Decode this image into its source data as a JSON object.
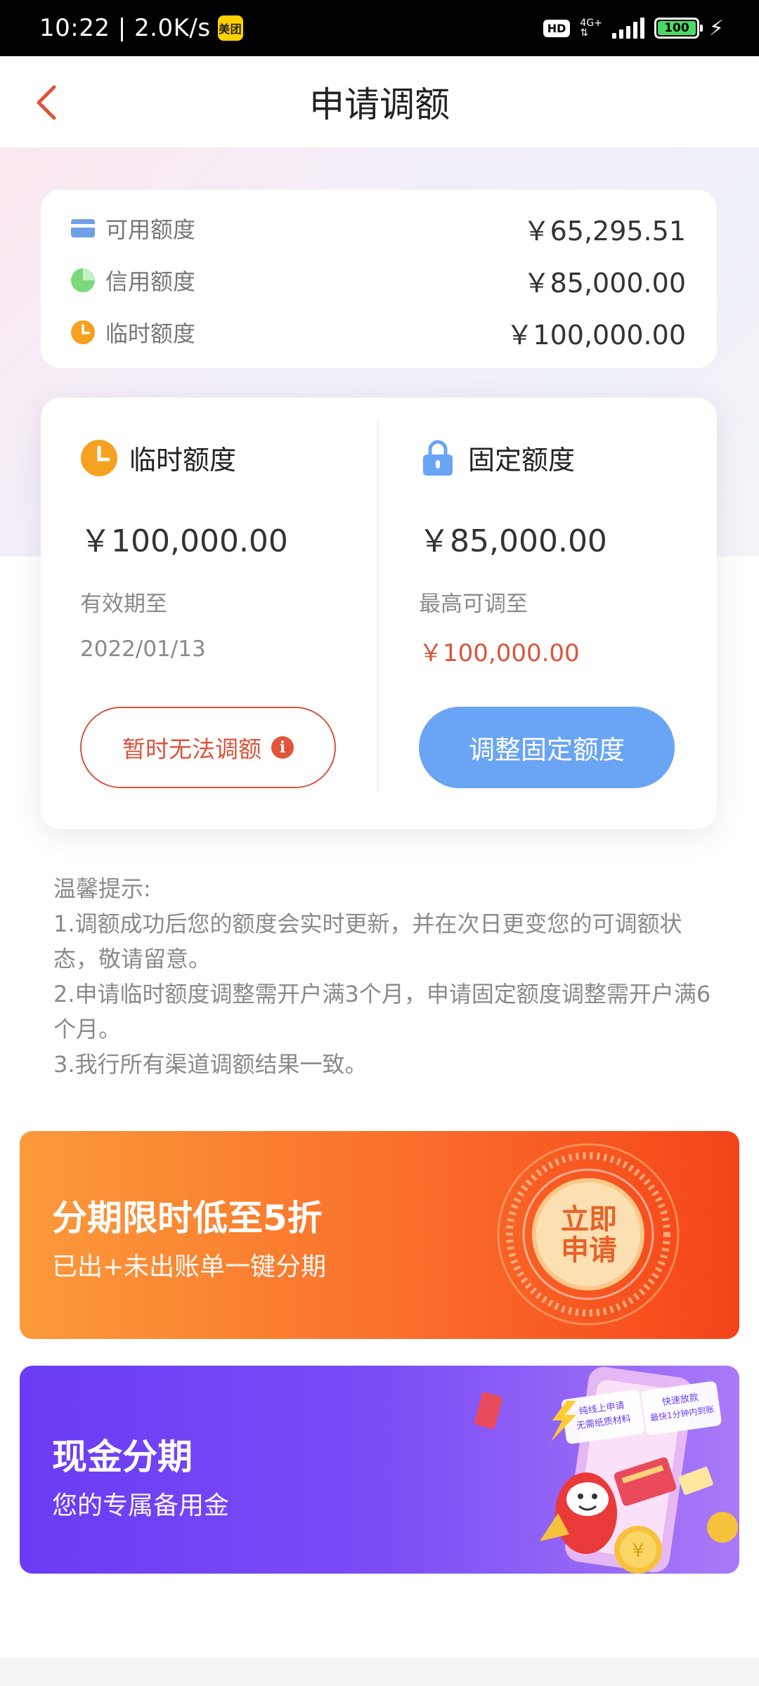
{
  "status_bar": {
    "time_speed": "10:22 | 2.0K/s",
    "app_badge": "美团",
    "hd": "HD",
    "network": "4G+",
    "battery": "100"
  },
  "nav": {
    "title": "申请调额"
  },
  "limits": [
    {
      "label": "可用额度",
      "value": "￥65,295.51",
      "icon": "card-icon",
      "color": "#6fa0e8"
    },
    {
      "label": "信用额度",
      "value": "￥85,000.00",
      "icon": "pie-icon",
      "color": "#7bd87d"
    },
    {
      "label": "临时额度",
      "value": "￥100,000.00",
      "icon": "clock-icon",
      "color": "#f6a11f"
    }
  ],
  "temporary": {
    "title": "临时额度",
    "amount": "￥100,000.00",
    "sub_label": "有效期至",
    "sub_value": "2022/01/13",
    "button_label": "暂时无法调额",
    "info_glyph": "i"
  },
  "fixed": {
    "title": "固定额度",
    "amount": "￥85,000.00",
    "sub_label": "最高可调至",
    "sub_value": "￥100,000.00",
    "button_label": "调整固定额度"
  },
  "tips": {
    "heading": "温馨提示:",
    "lines": [
      "1.调额成功后您的额度会实时更新，并在次日更变您的可调额状态，敬请留意。",
      "2.申请临时额度调整需开户满3个月，申请固定额度调整需开户满6个月。",
      "3.我行所有渠道调额结果一致。"
    ]
  },
  "banners": [
    {
      "title": "分期限时低至5折",
      "subtitle": "已出+未出账单一键分期",
      "stamp": "立即申请",
      "stamp_line1": "立即",
      "stamp_line2": "申请"
    },
    {
      "title": "现金分期",
      "subtitle": "您的专属备用金",
      "art_line1": "纯线上申请",
      "art_line2": "无需纸质材料",
      "art_line3": "快速放款",
      "art_line4": "最快1分钟内到账"
    }
  ],
  "colors": {
    "accent_red": "#d9543c",
    "button_blue": "#6aa4f5",
    "orange_banner": "#fa6e2a",
    "purple_banner": "#7a4cf5"
  }
}
